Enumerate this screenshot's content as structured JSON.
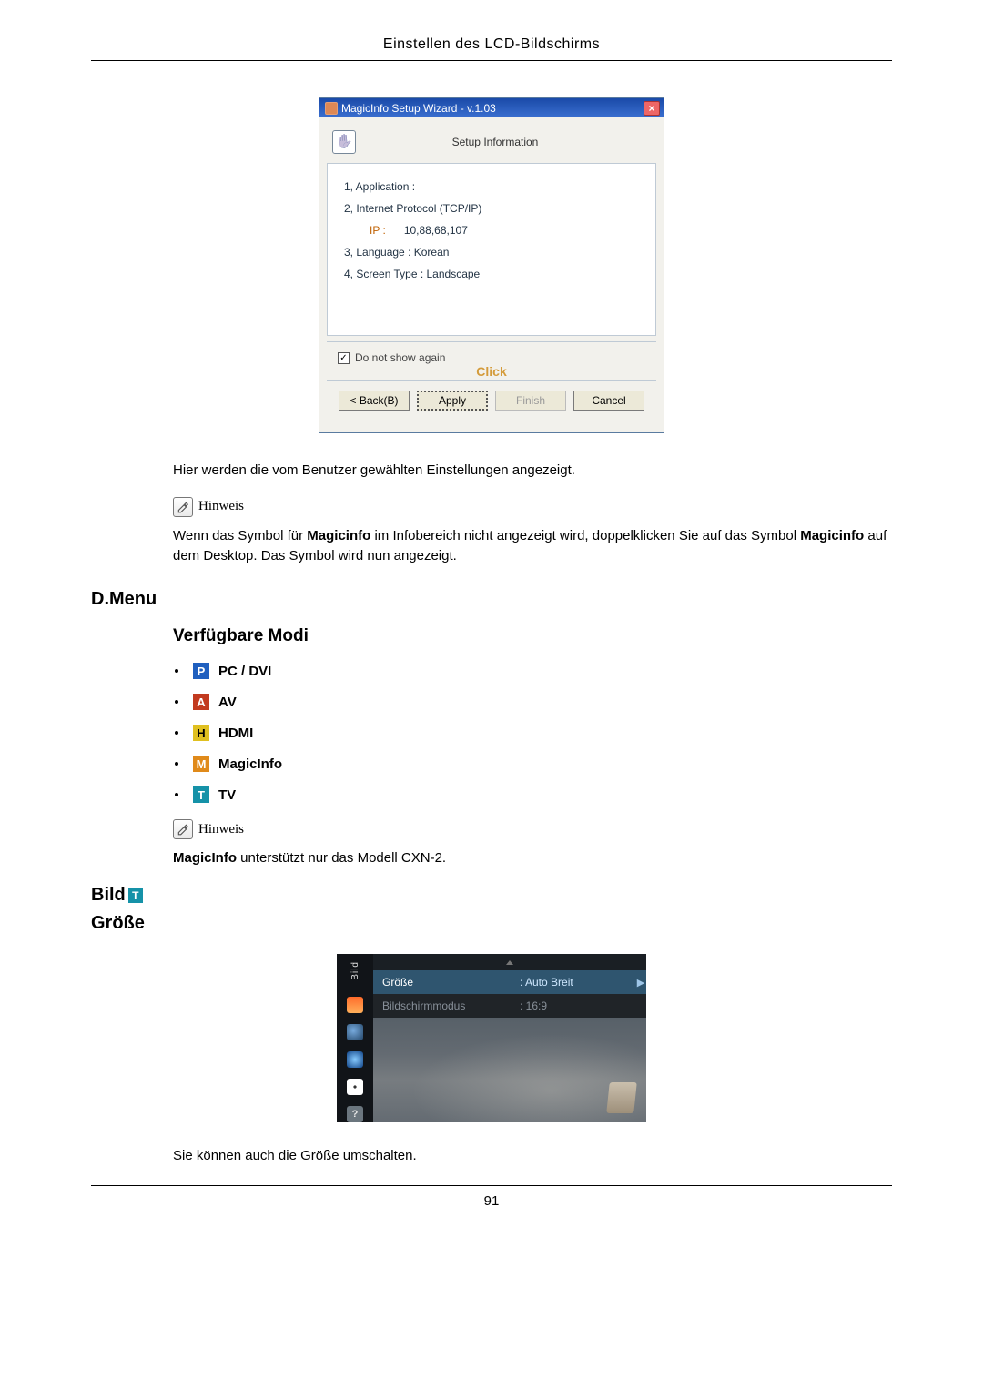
{
  "header": {
    "title": "Einstellen des LCD-Bildschirms"
  },
  "wizard": {
    "title": "MagicInfo Setup Wizard - v.1.03",
    "setup_heading": "Setup Information",
    "rows": {
      "r1": "1, Application :",
      "r2": "2, Internet Protocol (TCP/IP)",
      "ip_label": "IP :",
      "ip_value": "10,88,68,107",
      "r3": "3, Language :   Korean",
      "r4": "4, Screen Type  :  Landscape"
    },
    "do_not_show": "Do not show again",
    "click": "Click",
    "buttons": {
      "back": "< Back(B)",
      "apply": "Apply",
      "finish": "Finish",
      "cancel": "Cancel"
    }
  },
  "para1": "Hier werden die vom Benutzer gewählten Einstellungen angezeigt.",
  "hinweis_label": "Hinweis",
  "para2a": "Wenn das Symbol für ",
  "para2b": "Magicinfo",
  "para2c": " im Infobereich nicht angezeigt wird, doppelklicken Sie auf das Symbol ",
  "para2d": "Magicinfo",
  "para2e": " auf dem Desktop. Das Symbol wird nun angezeigt.",
  "dmenu_head": "D.Menu",
  "modes_head": "Verfügbare Modi",
  "modes": {
    "p": {
      "badge": "P",
      "label": "PC / DVI"
    },
    "a": {
      "badge": "A",
      "label": "AV"
    },
    "h": {
      "badge": "H",
      "label": "HDMI"
    },
    "m": {
      "badge": "M",
      "label": "MagicInfo"
    },
    "t": {
      "badge": "T",
      "label": "TV"
    }
  },
  "support_note_pre": "MagicInfo",
  "support_note_post": " unterstützt nur das Modell CXN-2.",
  "bild_head": "Bild",
  "groesse_head": "Größe",
  "osd": {
    "side_label": "Bild",
    "rows": [
      {
        "c1": "Größe",
        "c2": ": Auto Breit"
      },
      {
        "c1": "Bildschirmmodus",
        "c2": ": 16:9"
      }
    ],
    "qmark": "?"
  },
  "para3": "Sie können auch die Größe umschalten.",
  "page_number": "91"
}
